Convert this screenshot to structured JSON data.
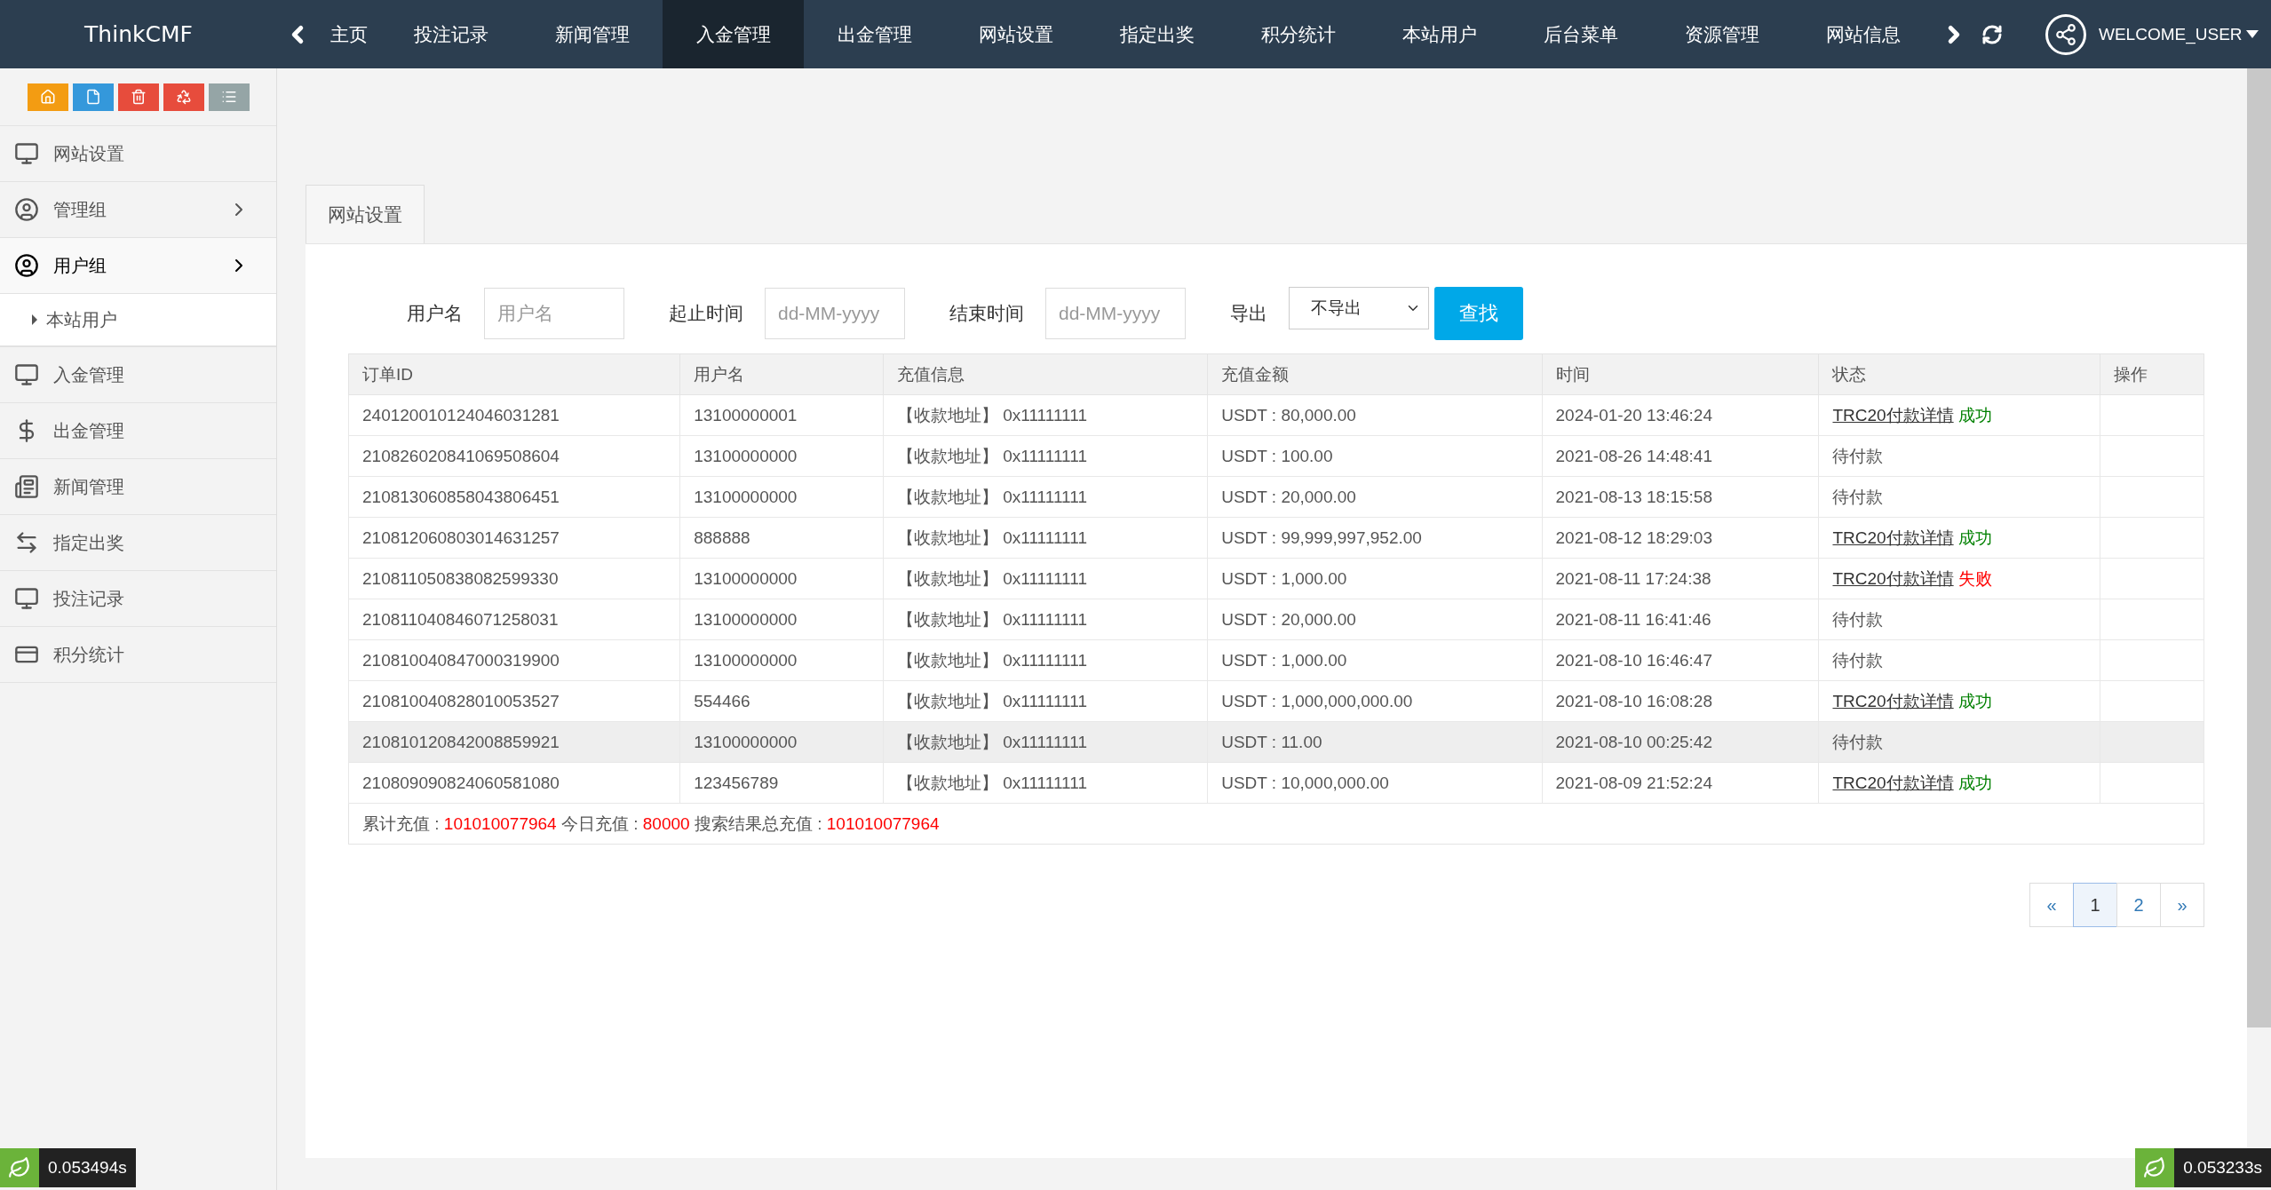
{
  "topbar": {
    "brand": "ThinkCMF",
    "nav": [
      {
        "label": "主页",
        "selected": false
      },
      {
        "label": "投注记录",
        "selected": false
      },
      {
        "label": "新闻管理",
        "selected": false
      },
      {
        "label": "入金管理",
        "selected": true
      },
      {
        "label": "出金管理",
        "selected": false
      },
      {
        "label": "网站设置",
        "selected": false
      },
      {
        "label": "指定出奖",
        "selected": false
      },
      {
        "label": "积分统计",
        "selected": false
      },
      {
        "label": "本站用户",
        "selected": false
      },
      {
        "label": "后台菜单",
        "selected": false
      },
      {
        "label": "资源管理",
        "selected": false
      },
      {
        "label": "网站信息",
        "selected": false
      }
    ],
    "user": "WELCOME_USER"
  },
  "sidebar": {
    "items": [
      {
        "label": "网站设置",
        "expandable": false,
        "expanded": false
      },
      {
        "label": "管理组",
        "expandable": true,
        "expanded": false
      },
      {
        "label": "用户组",
        "expandable": true,
        "expanded": true,
        "children": [
          {
            "label": "本站用户",
            "selected": true
          }
        ]
      },
      {
        "label": "入金管理",
        "expandable": false,
        "expanded": false
      },
      {
        "label": "出金管理",
        "expandable": false,
        "expanded": false
      },
      {
        "label": "新闻管理",
        "expandable": false,
        "expanded": false
      },
      {
        "label": "指定出奖",
        "expandable": false,
        "expanded": false
      },
      {
        "label": "投注记录",
        "expandable": false,
        "expanded": false
      },
      {
        "label": "积分统计",
        "expandable": false,
        "expanded": false
      }
    ]
  },
  "tabs": [
    {
      "label": "网站设置",
      "selected": true
    }
  ],
  "filters": [
    {
      "label": "用户名",
      "placeholder": "用户名"
    },
    {
      "label": "起止时间",
      "placeholder": "dd-MM-yyyy"
    },
    {
      "label": "结束时间",
      "placeholder": "dd-MM-yyyy"
    }
  ],
  "export": {
    "label": "导出",
    "value": "不导出"
  },
  "search_button": "查找",
  "table": {
    "columns": [
      "订单ID",
      "用户名",
      "充值信息",
      "充值金额",
      "时间",
      "状态",
      "操作"
    ],
    "rows": [
      {
        "id": "240120010124046031281",
        "user": "13100000001",
        "info": "【收款地址】 0x11111111",
        "amount": "USDT : 80,000.00",
        "time": "2024-01-20 13:46:24",
        "status": {
          "kind": "link",
          "link": "TRC20付款详情",
          "result": "成功",
          "color": "#008000"
        },
        "hovered": false
      },
      {
        "id": "210826020841069508604",
        "user": "13100000000",
        "info": "【收款地址】 0x11111111",
        "amount": "USDT : 100.00",
        "time": "2021-08-26 14:48:41",
        "status": {
          "kind": "pending",
          "text": "待付款"
        },
        "hovered": false
      },
      {
        "id": "210813060858043806451",
        "user": "13100000000",
        "info": "【收款地址】 0x11111111",
        "amount": "USDT : 20,000.00",
        "time": "2021-08-13 18:15:58",
        "status": {
          "kind": "pending",
          "text": "待付款"
        },
        "hovered": false
      },
      {
        "id": "210812060803014631257",
        "user": "888888",
        "info": "【收款地址】 0x11111111",
        "amount": "USDT : 99,999,997,952.00",
        "time": "2021-08-12 18:29:03",
        "status": {
          "kind": "link",
          "link": "TRC20付款详情",
          "result": "成功",
          "color": "#008000"
        },
        "hovered": false
      },
      {
        "id": "210811050838082599330",
        "user": "13100000000",
        "info": "【收款地址】 0x11111111",
        "amount": "USDT : 1,000.00",
        "time": "2021-08-11 17:24:38",
        "status": {
          "kind": "link",
          "link": "TRC20付款详情",
          "result": "失败",
          "color": "#ff0000"
        },
        "hovered": false
      },
      {
        "id": "210811040846071258031",
        "user": "13100000000",
        "info": "【收款地址】 0x11111111",
        "amount": "USDT : 20,000.00",
        "time": "2021-08-11 16:41:46",
        "status": {
          "kind": "pending",
          "text": "待付款"
        },
        "hovered": false
      },
      {
        "id": "210810040847000319900",
        "user": "13100000000",
        "info": "【收款地址】 0x11111111",
        "amount": "USDT : 1,000.00",
        "time": "2021-08-10 16:46:47",
        "status": {
          "kind": "pending",
          "text": "待付款"
        },
        "hovered": false
      },
      {
        "id": "210810040828010053527",
        "user": "554466",
        "info": "【收款地址】 0x11111111",
        "amount": "USDT : 1,000,000,000.00",
        "time": "2021-08-10 16:08:28",
        "status": {
          "kind": "link",
          "link": "TRC20付款详情",
          "result": "成功",
          "color": "#008000"
        },
        "hovered": false
      },
      {
        "id": "210810120842008859921",
        "user": "13100000000",
        "info": "【收款地址】 0x11111111",
        "amount": "USDT : 11.00",
        "time": "2021-08-10 00:25:42",
        "status": {
          "kind": "pending",
          "text": "待付款"
        },
        "hovered": true
      },
      {
        "id": "210809090824060581080",
        "user": "123456789",
        "info": "【收款地址】 0x11111111",
        "amount": "USDT : 10,000,000.00",
        "time": "2021-08-09 21:52:24",
        "status": {
          "kind": "link",
          "link": "TRC20付款详情",
          "result": "成功",
          "color": "#008000"
        },
        "hovered": false
      }
    ],
    "summary": [
      {
        "label": "累计充值 : ",
        "value": "101010077964"
      },
      {
        "label": " 今日充值 : ",
        "value": "80000"
      },
      {
        "label": " 搜索结果总充值 : ",
        "value": "101010077964"
      }
    ]
  },
  "pagination": [
    {
      "label": "«",
      "selected": false
    },
    {
      "label": "1",
      "selected": true
    },
    {
      "label": "2",
      "selected": false
    },
    {
      "label": "»",
      "selected": false
    }
  ],
  "timers": [
    "0.053494s",
    "0.053233s"
  ]
}
